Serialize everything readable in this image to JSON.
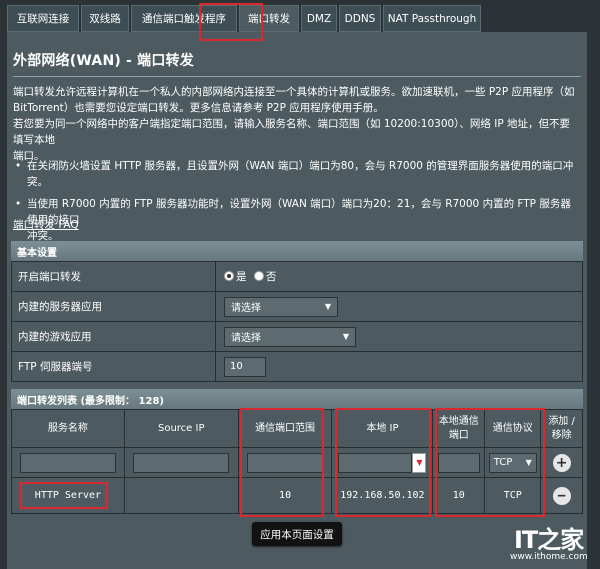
{
  "tabs": [
    {
      "label": "互联网连接"
    },
    {
      "label": "双线路"
    },
    {
      "label": "通信端口触发程序"
    },
    {
      "label": "端口转发"
    },
    {
      "label": "DMZ"
    },
    {
      "label": "DDNS"
    },
    {
      "label": "NAT Passthrough"
    }
  ],
  "page": {
    "title": "外部网络(WAN) - 端口转发",
    "desc_line1": "端口转发允许远程计算机在一个私人的内部网络内连接至一个具体的计算机或服务。欲加速联机，一些 P2P 应用程序（如",
    "desc_line2": "BitTorrent）也需要您设定端口转发。更多信息请参考 P2P 应用程序使用手册。",
    "desc_line3": "若您要为同一个网络中的客户端指定端口范围，请输入服务名称、端口范围（如 10200:10300）、网络 IP 地址，但不要填写本地",
    "desc_line4": "端口。",
    "bullet1": "在关闭防火墙设置 HTTP 服务器，且设置外网（WAN 端口）端口为80，会与 R7000 的管理界面服务器使用的端口冲突。",
    "bullet2a": "当使用 R7000 内置的 FTP 服务器功能时，设置外网（WAN 端口）端口为20：21，会与 R7000 内置的 FTP 服务器使用的接口",
    "bullet2b": "冲突。",
    "faq_link": "端口转发 FAQ"
  },
  "basic": {
    "title": "基本设置",
    "enable_label": "开启端口转发",
    "yes": "是",
    "no": "否",
    "server_app_label": "内建的服务器应用",
    "server_app_value": "请选择",
    "game_app_label": "内建的游戏应用",
    "game_app_value": "请选择",
    "ftp_label": "FTP 伺服器端号",
    "ftp_value": "10"
  },
  "rules": {
    "title": "端口转发列表 (最多限制： 128)",
    "headers": {
      "service": "服务名称",
      "source_ip": "Source IP",
      "port_range": "通信端口范围",
      "local_ip": "本地 IP",
      "local_port": "本地通信端口",
      "protocol": "通信协议",
      "add_remove": "添加 / 移除"
    },
    "input_protocol": "TCP",
    "row": {
      "service": "HTTP Server",
      "source_ip": "",
      "port_range": "10",
      "local_ip": "192.168.50.102",
      "local_port": "10",
      "protocol": "TCP"
    }
  },
  "apply_label": "应用本页面设置",
  "watermark": {
    "mark": "IT之家",
    "url": "www.ithome.com"
  },
  "colors": {
    "highlight": "#d9282f",
    "panel": "#4d5b60"
  }
}
